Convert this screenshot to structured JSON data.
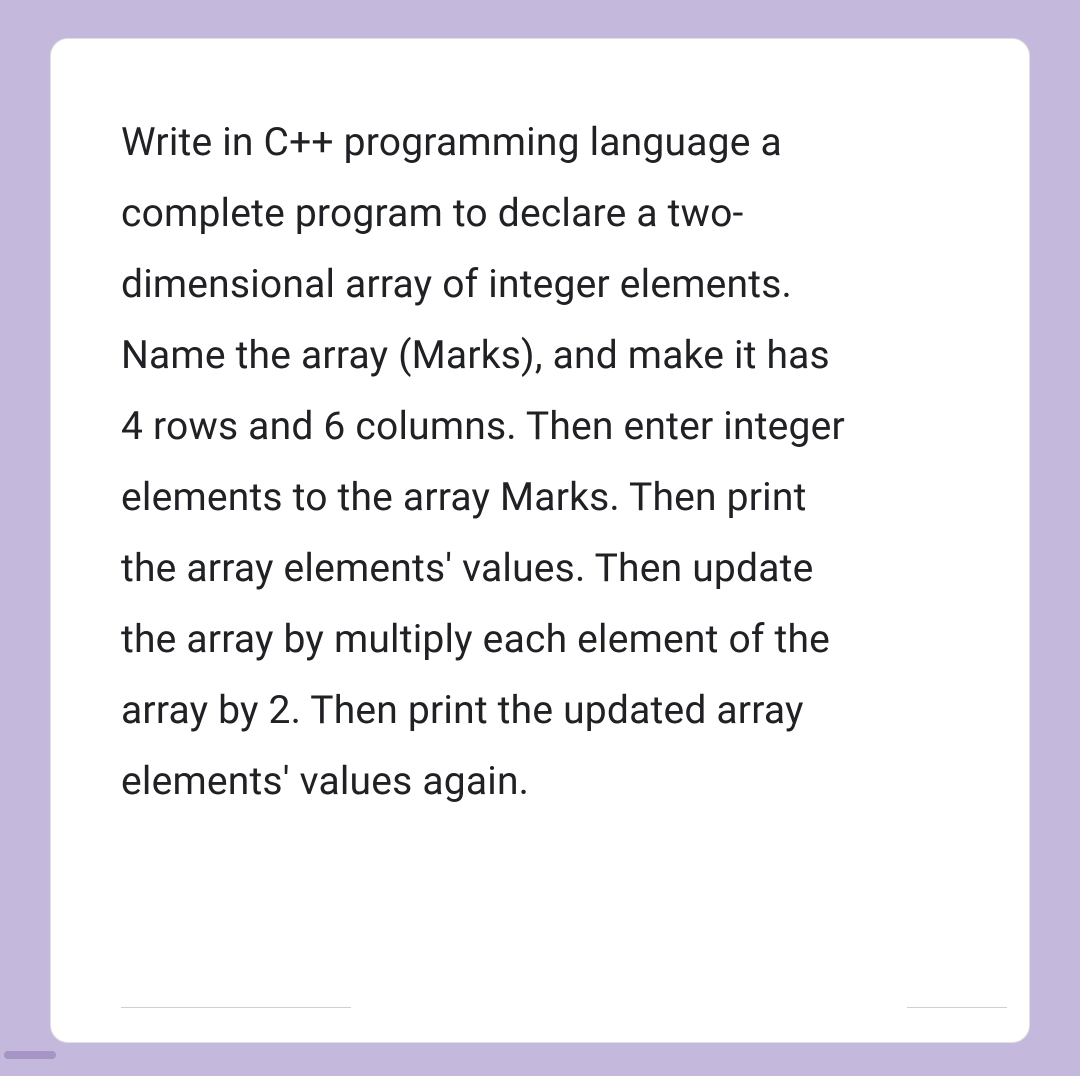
{
  "question": {
    "text": "Write in C++ programming language a complete program to declare a two-dimensional array of integer elements. Name the array (Marks), and make it has 4 rows and 6 columns. Then enter integer elements to the array Marks. Then print the array elements' values. Then update the array by multiply each element of the array by 2. Then print the updated array elements' values again."
  }
}
